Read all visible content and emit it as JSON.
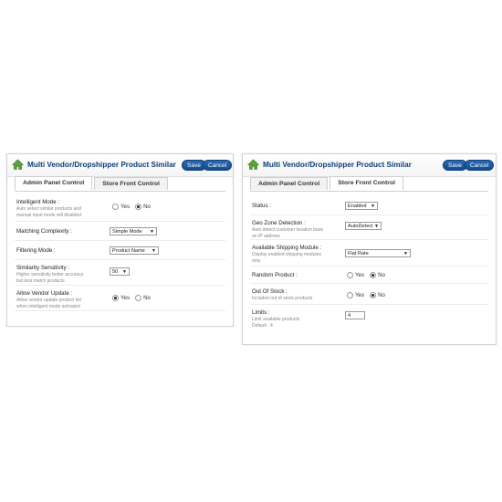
{
  "left_panel": {
    "title": "Multi Vendor/Dropshipper Product Similar",
    "save_label": "Save",
    "cancel_label": "Cancel",
    "tabs": [
      {
        "label": "Admin Panel Control",
        "active": true
      },
      {
        "label": "Store Front Control",
        "active": false
      }
    ],
    "fields": {
      "intelligent_mode": {
        "label": "Intelligent Mode :",
        "help1": "Auto select similar products and",
        "help2": "manual input mode will disabled",
        "yes": "Yes",
        "no": "No",
        "selected": "No"
      },
      "matching_complexity": {
        "label": "Matching Complexity :",
        "value": "Simple Mode"
      },
      "filtering_mode": {
        "label": "Filtering Mode :",
        "value": "Product Name"
      },
      "similarity_sensitivity": {
        "label": "Similarity Sensitivity :",
        "help1": "Higher sensitivity better accuracy",
        "help2": "but less match products",
        "value": "50"
      },
      "allow_vendor_update": {
        "label": "Allow Vendor Update :",
        "help1": "Allow vendor update product list",
        "help2": "when intelligent mode activated",
        "yes": "Yes",
        "no": "No",
        "selected": "Yes"
      }
    }
  },
  "right_panel": {
    "title": "Multi Vendor/Dropshipper Product Similar",
    "save_label": "Save",
    "cancel_label": "Cancel",
    "tabs": [
      {
        "label": "Admin Panel Control",
        "active": false
      },
      {
        "label": "Store Front Control",
        "active": true
      }
    ],
    "fields": {
      "status": {
        "label": "Status :",
        "value": "Enabled"
      },
      "geo_zone": {
        "label": "Geo Zone Detection :",
        "help1": "Auto detect customer location base",
        "help2": "on IP address",
        "value": "AutoDetect"
      },
      "shipping_module": {
        "label": "Available Shipping Module :",
        "help1": "Display enabled shipping modules",
        "help2": "only.",
        "value": "Flat Rate"
      },
      "random_product": {
        "label": "Random Product :",
        "yes": "Yes",
        "no": "No",
        "selected": "No"
      },
      "out_of_stock": {
        "label": "Out Of Stock :",
        "help1": "Included out of stock products",
        "yes": "Yes",
        "no": "No",
        "selected": "No"
      },
      "limits": {
        "label": "Limits :",
        "help1": "Limit available products",
        "help2": "Default : 4",
        "value": "4"
      }
    }
  }
}
